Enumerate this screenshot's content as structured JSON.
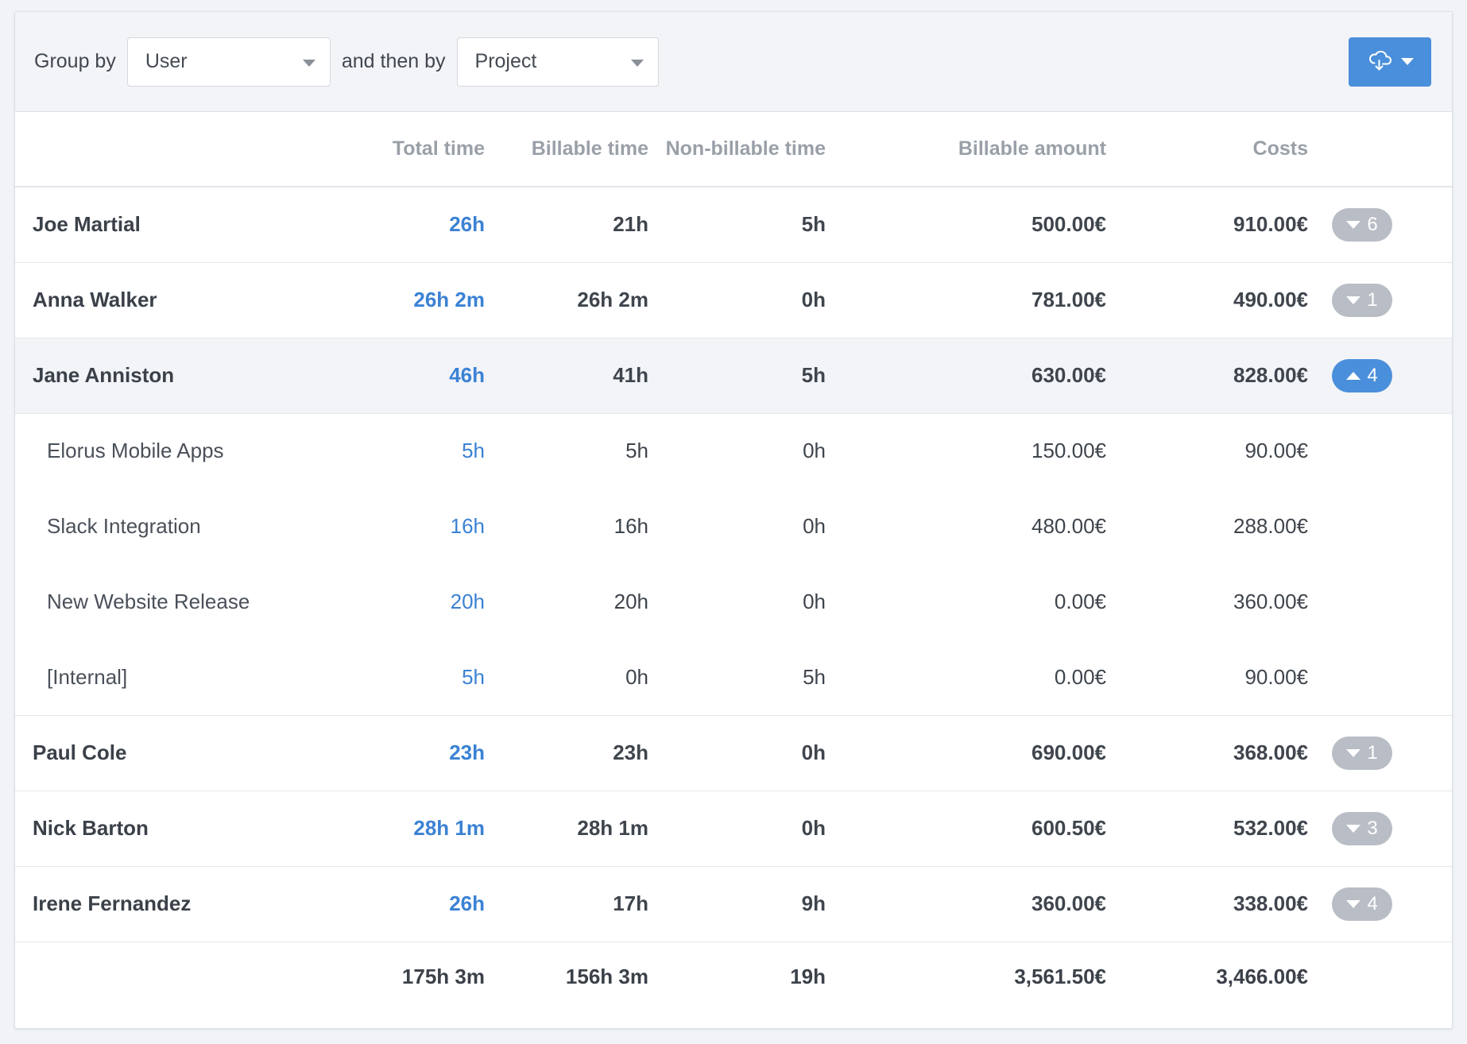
{
  "toolbar": {
    "group_by_label": "Group by",
    "and_then_by_label": "and then by",
    "group_by_value": "User",
    "then_by_value": "Project",
    "export_icon": "cloud-download-icon",
    "export_caret_icon": "caret-down-icon",
    "accent_color": "#4a8fdb",
    "link_color": "#3b82d4",
    "badge_color": "#b9bdc5"
  },
  "table": {
    "headers": {
      "name": "",
      "total_time": "Total time",
      "billable_time": "Billable time",
      "non_billable_time": "Non-billable time",
      "billable_amount": "Billable amount",
      "costs": "Costs"
    },
    "rows": [
      {
        "name": "Joe Martial",
        "total_time": "26h",
        "billable_time": "21h",
        "non_billable_time": "5h",
        "billable_amount": "500.00€",
        "costs": "910.00€",
        "badge_count": "6",
        "expanded": false,
        "children": []
      },
      {
        "name": "Anna Walker",
        "total_time": "26h 2m",
        "billable_time": "26h 2m",
        "non_billable_time": "0h",
        "billable_amount": "781.00€",
        "costs": "490.00€",
        "badge_count": "1",
        "expanded": false,
        "children": []
      },
      {
        "name": "Jane Anniston",
        "total_time": "46h",
        "billable_time": "41h",
        "non_billable_time": "5h",
        "billable_amount": "630.00€",
        "costs": "828.00€",
        "badge_count": "4",
        "expanded": true,
        "children": [
          {
            "name": "Elorus Mobile Apps",
            "total_time": "5h",
            "billable_time": "5h",
            "non_billable_time": "0h",
            "billable_amount": "150.00€",
            "costs": "90.00€"
          },
          {
            "name": "Slack Integration",
            "total_time": "16h",
            "billable_time": "16h",
            "non_billable_time": "0h",
            "billable_amount": "480.00€",
            "costs": "288.00€"
          },
          {
            "name": "New Website Release",
            "total_time": "20h",
            "billable_time": "20h",
            "non_billable_time": "0h",
            "billable_amount": "0.00€",
            "costs": "360.00€"
          },
          {
            "name": "[Internal]",
            "total_time": "5h",
            "billable_time": "0h",
            "non_billable_time": "5h",
            "billable_amount": "0.00€",
            "costs": "90.00€"
          }
        ]
      },
      {
        "name": "Paul Cole",
        "total_time": "23h",
        "billable_time": "23h",
        "non_billable_time": "0h",
        "billable_amount": "690.00€",
        "costs": "368.00€",
        "badge_count": "1",
        "expanded": false,
        "children": []
      },
      {
        "name": "Nick Barton",
        "total_time": "28h 1m",
        "billable_time": "28h 1m",
        "non_billable_time": "0h",
        "billable_amount": "600.50€",
        "costs": "532.00€",
        "badge_count": "3",
        "expanded": false,
        "children": []
      },
      {
        "name": "Irene Fernandez",
        "total_time": "26h",
        "billable_time": "17h",
        "non_billable_time": "9h",
        "billable_amount": "360.00€",
        "costs": "338.00€",
        "badge_count": "4",
        "expanded": false,
        "children": []
      }
    ],
    "totals": {
      "name": "",
      "total_time": "175h 3m",
      "billable_time": "156h 3m",
      "non_billable_time": "19h",
      "billable_amount": "3,561.50€",
      "costs": "3,466.00€"
    }
  }
}
